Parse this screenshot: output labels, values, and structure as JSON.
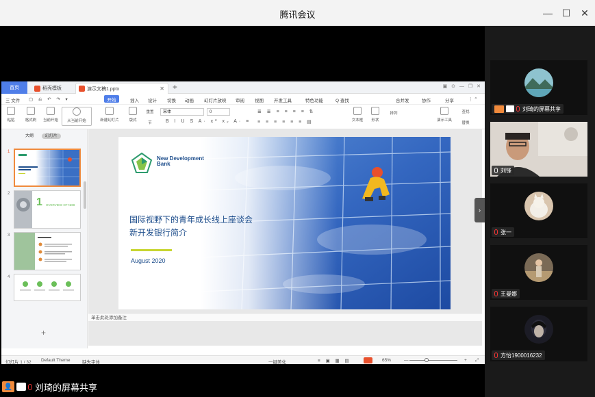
{
  "window": {
    "title": "腾讯会议",
    "minimize_icon": "minimize-icon",
    "maximize_icon": "maximize-icon",
    "close_icon": "close-icon"
  },
  "wps": {
    "home_tab": "首页",
    "tabs": [
      {
        "label": "稻壳模板"
      },
      {
        "label": "演示文稿1.pptx"
      }
    ],
    "menu": [
      "三 文件",
      "开始",
      "插入",
      "设计",
      "切换",
      "动画",
      "幻灯片放映",
      "审阅",
      "视图",
      "开发工具",
      "特色功能",
      "Q 查找"
    ],
    "menu_right": [
      "合并发",
      "协作",
      "分享"
    ],
    "ribbon": {
      "buttons": [
        "粘贴",
        "格式刷",
        "当前开始",
        "从当前开始",
        "新建幻灯片",
        "版式",
        "节",
        "重置"
      ],
      "font_field": "宋体",
      "size_field": "0",
      "right_buttons": [
        "文本框",
        "形状",
        "排列",
        "演示工具",
        "查找",
        "替换"
      ]
    },
    "thumbs": {
      "tab_outline": "大纲",
      "tab_slides": "幻灯片",
      "items": [
        {
          "num": "1"
        },
        {
          "num": "2",
          "label": "OVERVIEW OF NDB",
          "big": "1"
        },
        {
          "num": "3"
        },
        {
          "num": "4"
        }
      ]
    },
    "slide": {
      "logo_name": "New Development Bank",
      "title_line1": "国际视野下的青年成长线上座谈会",
      "title_line2": "新开发银行简介",
      "date": "August 2020"
    },
    "notes_hint": "单击此处添加备注",
    "status": {
      "slide_count": "幻灯片 1 / 32",
      "theme": "Default Theme",
      "missing_font": "缺失字体",
      "beautify": "一键美化",
      "zoom": "65%"
    }
  },
  "sharer_label": "刘琦的屏幕共享",
  "participants": [
    {
      "name": "刘琦的屏幕共享",
      "avatar": "landscape"
    },
    {
      "name": "刘锋",
      "avatar": "camera"
    },
    {
      "name": "张一",
      "avatar": "cat"
    },
    {
      "name": "王曼娜",
      "avatar": "girl"
    },
    {
      "name": "方怡1900016232",
      "avatar": "dark"
    }
  ],
  "colors": {
    "accent": "#4f7ee9",
    "wps_orange": "#e8502c",
    "meeting_orange": "#f08a3c",
    "ndb_blue": "#1e4e8c",
    "ndb_green": "#c7d530"
  }
}
